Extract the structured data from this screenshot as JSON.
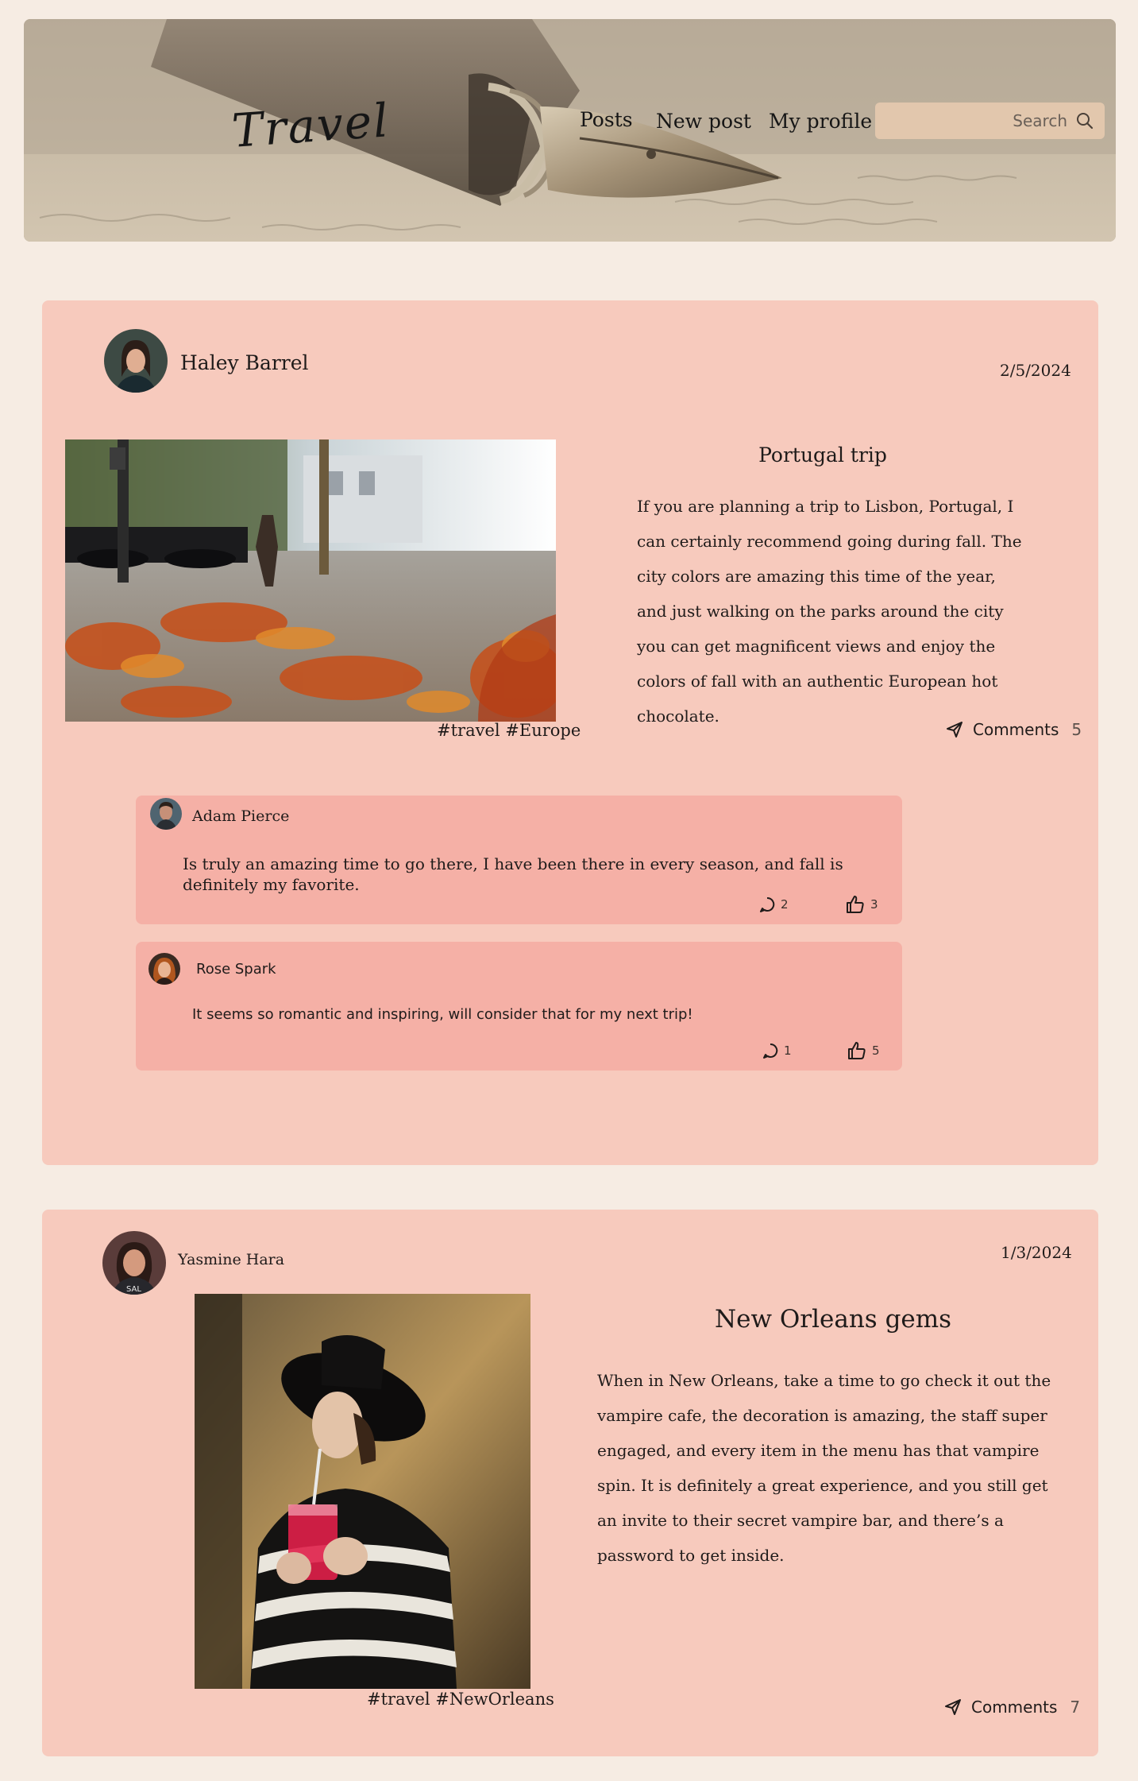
{
  "header": {
    "logo": "Travel",
    "nav": {
      "posts": "Posts",
      "new_post": "New post",
      "my_profile": "My profile"
    },
    "search": {
      "placeholder": "Search",
      "icon": "search-icon"
    }
  },
  "posts": [
    {
      "author": "Haley Barrel",
      "date": "2/5/2024",
      "title": "Portugal trip",
      "body": "If you are planning a trip to Lisbon, Portugal, I can certainly recommend going during fall. The city colors are amazing this time of the year, and just walking on the parks around the city you can get magnificent views and enjoy the colors of fall with an authentic European hot chocolate.",
      "tags": "#travel #Europe",
      "comments_label": "Comments",
      "comments_count": "5",
      "comments": [
        {
          "author": "Adam Pierce",
          "text": "Is truly an amazing time to go there, I have been there in every season, and fall is definitely my favorite.",
          "replies": "2",
          "likes": "3"
        },
        {
          "author": "Rose Spark",
          "text": "It seems so romantic and inspiring, will consider that for my next trip!",
          "replies": "1",
          "likes": "5"
        }
      ]
    },
    {
      "author": "Yasmine Hara",
      "date": "1/3/2024",
      "title": "New Orleans gems",
      "body": "When in New Orleans, take a time to go check it out the vampire cafe, the decoration is amazing, the staff super engaged, and every item in the menu has that vampire spin. It is definitely a great experience, and you still get an invite to their secret vampire bar, and there’s a password to get inside.",
      "tags": "#travel #NewOrleans",
      "comments_label": "Comments",
      "comments_count": "7"
    }
  ],
  "colors": {
    "page_bg": "#f6ece3",
    "card_bg": "#f7cabd",
    "comment_bg": "#f5b0a6",
    "search_bg": "#e2c7ad"
  }
}
